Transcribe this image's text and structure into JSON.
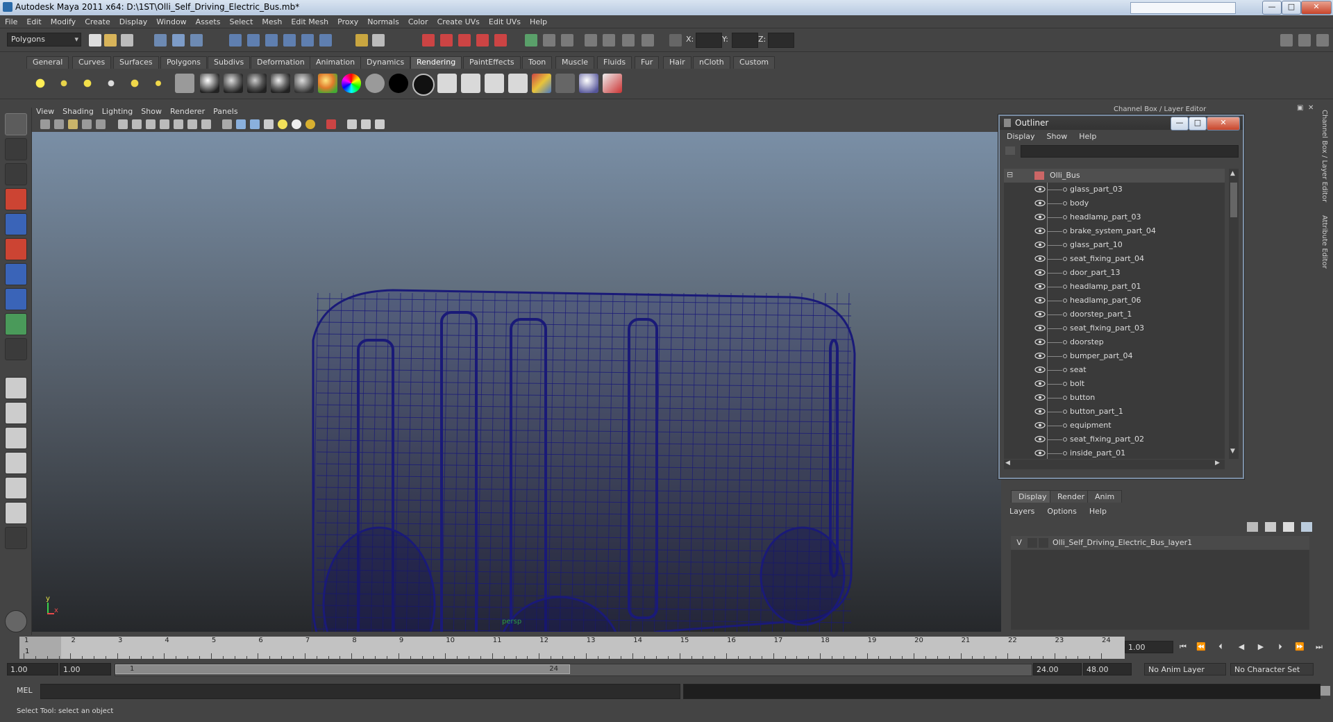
{
  "window": {
    "title": "Autodesk Maya 2011 x64: D:\\1ST\\Olli_Self_Driving_Electric_Bus.mb*",
    "min": "—",
    "max": "□",
    "close": "✕"
  },
  "menubar": [
    "File",
    "Edit",
    "Modify",
    "Create",
    "Display",
    "Window",
    "Assets",
    "Select",
    "Mesh",
    "Edit Mesh",
    "Proxy",
    "Normals",
    "Color",
    "Create UVs",
    "Edit UVs",
    "Help"
  ],
  "statusline": {
    "mode": "Polygons",
    "x_label": "X:",
    "y_label": "Y:",
    "z_label": "Z:"
  },
  "shelf_tabs": [
    "General",
    "Curves",
    "Surfaces",
    "Polygons",
    "Subdivs",
    "Deformation",
    "Animation",
    "Dynamics",
    "Rendering",
    "PaintEffects",
    "Toon",
    "Muscle",
    "Fluids",
    "Fur",
    "Hair",
    "nCloth",
    "Custom"
  ],
  "active_shelf_tab": "Rendering",
  "viewport": {
    "menu": [
      "View",
      "Shading",
      "Lighting",
      "Show",
      "Renderer",
      "Panels"
    ],
    "camera_label": "persp",
    "axis_y": "y",
    "axis_x": "x",
    "wire_color": "#1a1a78"
  },
  "channel_box_header": "Channel Box / Layer Editor",
  "side_tabs": [
    "Channel Box / Layer Editor",
    "Attribute Editor"
  ],
  "outliner": {
    "title": "Outliner",
    "menu": [
      "Display",
      "Show",
      "Help"
    ],
    "root": "Olli_Bus",
    "items": [
      "glass_part_03",
      "body",
      "headlamp_part_03",
      "brake_system_part_04",
      "glass_part_10",
      "seat_fixing_part_04",
      "door_part_13",
      "headlamp_part_01",
      "headlamp_part_06",
      "doorstep_part_1",
      "seat_fixing_part_03",
      "doorstep",
      "bumper_part_04",
      "seat",
      "bolt",
      "button",
      "button_part_1",
      "equipment",
      "seat_fixing_part_02",
      "inside_part_01"
    ]
  },
  "layer_editor": {
    "tabs": [
      "Display",
      "Render",
      "Anim"
    ],
    "menu": [
      "Layers",
      "Options",
      "Help"
    ],
    "layers": [
      {
        "visible": "V",
        "name": "Olli_Self_Driving_Electric_Bus_layer1"
      }
    ]
  },
  "timeline": {
    "ticks": [
      "1",
      "2",
      "3",
      "4",
      "5",
      "6",
      "7",
      "8",
      "9",
      "10",
      "11",
      "12",
      "13",
      "14",
      "15",
      "16",
      "17",
      "18",
      "19",
      "20",
      "21",
      "22",
      "23",
      "24"
    ],
    "current_frame_marker": "1",
    "current_frame": "1.00"
  },
  "range": {
    "start": "1.00",
    "playback_start": "1.00",
    "slider_start": "1",
    "slider_end": "24",
    "playback_end": "24.00",
    "end": "48.00",
    "anim_layer": "No Anim Layer",
    "character_set": "No Character Set"
  },
  "cmdline": {
    "label": "MEL"
  },
  "helpline": {
    "text": "Select Tool: select an object"
  }
}
